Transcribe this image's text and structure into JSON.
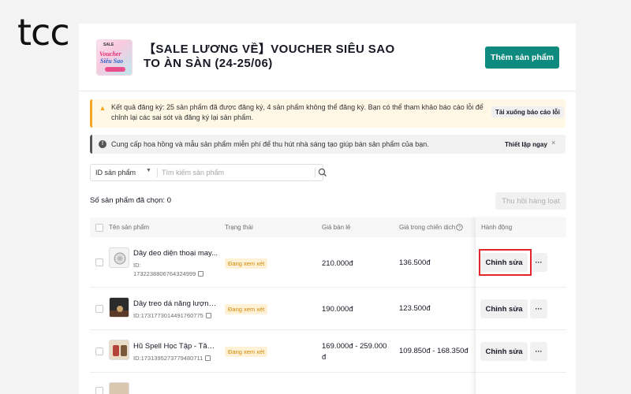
{
  "brand": {
    "logo_text": "tcc"
  },
  "header": {
    "campaign_title": "【SALE LƯƠNG VỀ】VOUCHER SIÊU SAO TO ÀN SÀN (24-25/06)",
    "thumbnail_texts": [
      "Voucher",
      "Siêu Sao"
    ],
    "add_product_label": "Thêm sản phẩm"
  },
  "alerts": {
    "warning": {
      "icon": "warning-triangle-icon",
      "message": "Kết quả đăng ký: 25 sản phẩm đã được đăng ký, 4 sản phẩm không thể đăng ký. Bạn có thể tham khảo báo cáo lỗi để chỉnh lại các sai sót và đăng ký lại sản phẩm.",
      "action_label": "Tải xuống báo cáo lỗi"
    },
    "info": {
      "icon": "info-icon",
      "message": "Cung cấp hoa hồng và mẫu sản phẩm miễn phí để thu hút nhà sáng tạo giúp bán sản phẩm của bạn.",
      "action_label": "Thiết lập ngay",
      "close_glyph": "×"
    }
  },
  "search": {
    "filter_selected": "ID sản phẩm",
    "placeholder": "Tìm kiếm sản phẩm"
  },
  "selection": {
    "count_label": "Số sản phẩm đã chọn: 0",
    "bulk_action_label": "Thu hồi hàng loạt"
  },
  "table": {
    "headers": {
      "name": "Tên sản phẩm",
      "status": "Trạng thái",
      "retail_price": "Giá bán lẻ",
      "campaign_price": "Giá trong chiến dịch",
      "actions": "Hành động"
    },
    "rows": [
      {
        "name": "Dây deo diện thoại may...",
        "id_label": "ID:",
        "id": "1732238806764324999",
        "status": "Đang xem xét",
        "retail_price": "210.000đ",
        "campaign_price": "136.500đ",
        "edit_label": "Chỉnh sửa",
        "more_label": "···"
      },
      {
        "name": "Dây treo dá năng lượng ...",
        "id": "ID:1731773014491760775",
        "status": "Đang xem xét",
        "retail_price": "190.000đ",
        "campaign_price": "123.500đ",
        "edit_label": "Chỉnh sửa",
        "more_label": "···"
      },
      {
        "name": "Hũ Spell Học Tập - Tăng...",
        "id": "ID:1731395273779480711",
        "status": "Đang xem xét",
        "retail_price": "169.000đ - 259.000 đ",
        "campaign_price": "109.850đ - 168.350đ",
        "edit_label": "Chỉnh sửa",
        "more_label": "···"
      }
    ]
  },
  "colors": {
    "primary": "#0e8a7e",
    "warning": "#f5a623",
    "highlight": "#e3262b",
    "badge_bg": "#fff1d6",
    "badge_text": "#d48806"
  }
}
